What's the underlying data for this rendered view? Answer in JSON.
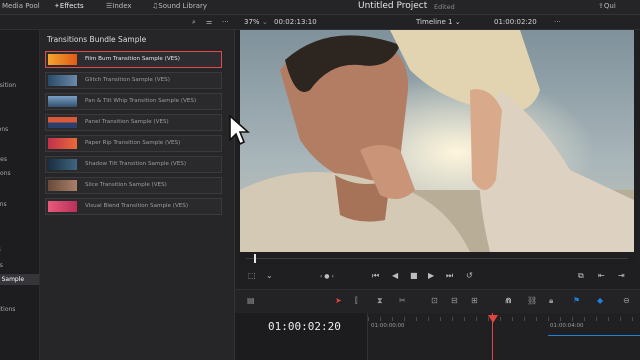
{
  "topbar": {
    "media_pool": "Media Pool",
    "effects": "Effects",
    "index": "Index",
    "sound_library": "Sound Library",
    "project_title": "Untitled Project",
    "edited": "Edited",
    "quick": "Qui"
  },
  "subbar": {
    "zoom": "37%",
    "source_timecode": "00:02:13:10",
    "timeline_name": "Timeline 1",
    "timeline_chevron": "⌄",
    "record_timecode": "01:00:02:20",
    "dots": "···"
  },
  "sidebar": {
    "items": [
      {
        "label": "nsition"
      },
      {
        "label": "ions"
      },
      {
        "label": "ries"
      },
      {
        "label": "tions"
      },
      {
        "label": "ons"
      },
      {
        "label": "ls"
      },
      {
        "label": "ns"
      },
      {
        "label": "e Sample",
        "selected": true
      },
      {
        "label": "sitions"
      }
    ]
  },
  "panel": {
    "header": "Transitions Bundle Sample",
    "items": [
      {
        "label": "Film Burn Transition Sample (VES)",
        "selected": true,
        "thumb": "#e08a2a"
      },
      {
        "label": "Glitch Transition Sample (VES)",
        "thumb": "#3a5a7a"
      },
      {
        "label": "Pan & Tilt Whip Transition Sample (VES)",
        "thumb": "#5a7fa0"
      },
      {
        "label": "Panel Transition Sample (VES)",
        "thumb": "#c24a3a"
      },
      {
        "label": "Paper Rip Transition Sample (VES)",
        "thumb": "#c23a55"
      },
      {
        "label": "Shadow Tilt Transition Sample (VES)",
        "thumb": "#24425a"
      },
      {
        "label": "Slice Transition Sample (VES)",
        "thumb": "#5a3a2a"
      },
      {
        "label": "Visual Blend Transition Sample (VES)",
        "thumb": "#d04a6a"
      }
    ]
  },
  "timeline": {
    "timecode": "01:00:02:20",
    "ruler_start": "01:00:00:00",
    "ruler_mid": "01:00:04:00"
  },
  "icons": [
    "search-icon",
    "sliders-icon",
    "more-icon",
    "play-icon",
    "stop-icon",
    "skip-back-icon",
    "skip-forward-icon",
    "loop-icon",
    "pointer-icon",
    "razor-icon",
    "link-icon",
    "lock-icon",
    "magnet-icon",
    "flag-icon"
  ],
  "colors": {
    "accent_red": "#e2453d",
    "accent_blue": "#1e7fd6"
  }
}
